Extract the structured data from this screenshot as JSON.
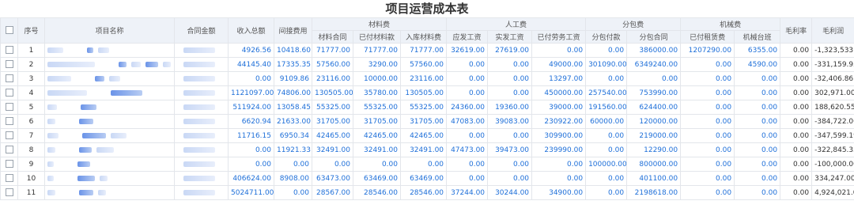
{
  "title": "项目运营成本表",
  "groups": {
    "material": "材料费",
    "labor": "人工费",
    "subcontract": "分包费",
    "machinery": "机械费"
  },
  "columns": {
    "seq": "序号",
    "project_name": "项目名称",
    "contract_amount": "合同金额",
    "total_income": "收入总额",
    "indirect_cost": "间接费用",
    "material_contract": "材料合同",
    "material_paid": "已付材料款",
    "material_inbound": "入库材料费",
    "labor_due": "应发工资",
    "labor_actual": "实发工资",
    "labor_paid": "已付劳务工资",
    "sub_paid": "分包付款",
    "sub_contract": "分包合同",
    "mach_rent_paid": "已付租赁费",
    "mach_shift": "机械台班",
    "gross_rate": "毛利率",
    "gross_profit": "毛利润"
  },
  "rows": [
    {
      "seq": "1",
      "total_income": "4926.56",
      "indirect_cost": "10418.60",
      "material_contract": "71777.00",
      "material_paid": "71777.00",
      "material_inbound": "71777.00",
      "labor_due": "32619.00",
      "labor_actual": "27619.00",
      "labor_paid": "0.00",
      "sub_paid": "0.00",
      "sub_contract": "386000.00",
      "mach_rent_paid": "1207290.00",
      "mach_shift": "6355.00",
      "gross_rate": "0.00",
      "gross_profit": "-1,323,533.04"
    },
    {
      "seq": "2",
      "total_income": "44145.40",
      "indirect_cost": "17335.35",
      "material_contract": "57560.00",
      "material_paid": "3290.00",
      "material_inbound": "57560.00",
      "labor_due": "0.00",
      "labor_actual": "0.00",
      "labor_paid": "49000.00",
      "sub_paid": "301090.00",
      "sub_contract": "6349240.00",
      "mach_rent_paid": "0.00",
      "mach_shift": "4590.00",
      "gross_rate": "0.00",
      "gross_profit": "-331,159.95"
    },
    {
      "seq": "3",
      "total_income": "0.00",
      "indirect_cost": "9109.86",
      "material_contract": "23116.00",
      "material_paid": "10000.00",
      "material_inbound": "23116.00",
      "labor_due": "0.00",
      "labor_actual": "0.00",
      "labor_paid": "13297.00",
      "sub_paid": "0.00",
      "sub_contract": "0.00",
      "mach_rent_paid": "0.00",
      "mach_shift": "0.00",
      "gross_rate": "0.00",
      "gross_profit": "-32,406.86"
    },
    {
      "seq": "4",
      "total_income": "1121097.00",
      "indirect_cost": "74806.00",
      "material_contract": "130505.00",
      "material_paid": "35780.00",
      "material_inbound": "130505.00",
      "labor_due": "0.00",
      "labor_actual": "0.00",
      "labor_paid": "450000.00",
      "sub_paid": "257540.00",
      "sub_contract": "753990.00",
      "mach_rent_paid": "0.00",
      "mach_shift": "0.00",
      "gross_rate": "0.00",
      "gross_profit": "302,971.00"
    },
    {
      "seq": "5",
      "total_income": "511924.00",
      "indirect_cost": "13058.45",
      "material_contract": "55325.00",
      "material_paid": "55325.00",
      "material_inbound": "55325.00",
      "labor_due": "24360.00",
      "labor_actual": "19360.00",
      "labor_paid": "39000.00",
      "sub_paid": "191560.00",
      "sub_contract": "624400.00",
      "mach_rent_paid": "0.00",
      "mach_shift": "0.00",
      "gross_rate": "0.00",
      "gross_profit": "188,620.55"
    },
    {
      "seq": "6",
      "total_income": "6620.94",
      "indirect_cost": "21633.00",
      "material_contract": "31705.00",
      "material_paid": "31705.00",
      "material_inbound": "31705.00",
      "labor_due": "47083.00",
      "labor_actual": "39083.00",
      "labor_paid": "230922.00",
      "sub_paid": "60000.00",
      "sub_contract": "120000.00",
      "mach_rent_paid": "0.00",
      "mach_shift": "0.00",
      "gross_rate": "0.00",
      "gross_profit": "-384,722.06"
    },
    {
      "seq": "7",
      "total_income": "11716.15",
      "indirect_cost": "6950.34",
      "material_contract": "42465.00",
      "material_paid": "42465.00",
      "material_inbound": "42465.00",
      "labor_due": "0.00",
      "labor_actual": "0.00",
      "labor_paid": "309900.00",
      "sub_paid": "0.00",
      "sub_contract": "219000.00",
      "mach_rent_paid": "0.00",
      "mach_shift": "0.00",
      "gross_rate": "0.00",
      "gross_profit": "-347,599.19"
    },
    {
      "seq": "8",
      "total_income": "0.00",
      "indirect_cost": "11921.33",
      "material_contract": "32491.00",
      "material_paid": "32491.00",
      "material_inbound": "32491.00",
      "labor_due": "47473.00",
      "labor_actual": "39473.00",
      "labor_paid": "239990.00",
      "sub_paid": "0.00",
      "sub_contract": "12290.00",
      "mach_rent_paid": "0.00",
      "mach_shift": "0.00",
      "gross_rate": "0.00",
      "gross_profit": "-322,845.33"
    },
    {
      "seq": "9",
      "total_income": "0.00",
      "indirect_cost": "0.00",
      "material_contract": "0.00",
      "material_paid": "0.00",
      "material_inbound": "0.00",
      "labor_due": "0.00",
      "labor_actual": "0.00",
      "labor_paid": "0.00",
      "sub_paid": "100000.00",
      "sub_contract": "800000.00",
      "mach_rent_paid": "0.00",
      "mach_shift": "0.00",
      "gross_rate": "0.00",
      "gross_profit": "-100,000.00"
    },
    {
      "seq": "10",
      "total_income": "406624.00",
      "indirect_cost": "8908.00",
      "material_contract": "63473.00",
      "material_paid": "63469.00",
      "material_inbound": "63469.00",
      "labor_due": "0.00",
      "labor_actual": "0.00",
      "labor_paid": "0.00",
      "sub_paid": "0.00",
      "sub_contract": "401100.00",
      "mach_rent_paid": "0.00",
      "mach_shift": "0.00",
      "gross_rate": "0.00",
      "gross_profit": "334,247.00"
    },
    {
      "seq": "11",
      "total_income": "5024711.00",
      "indirect_cost": "0.00",
      "material_contract": "28567.00",
      "material_paid": "28546.00",
      "material_inbound": "28546.00",
      "labor_due": "37244.00",
      "labor_actual": "30244.00",
      "labor_paid": "34900.00",
      "sub_paid": "0.00",
      "sub_contract": "2198618.00",
      "mach_rent_paid": "0.00",
      "mach_shift": "0.00",
      "gross_rate": "0.00",
      "gross_profit": "4,924,021.00"
    }
  ]
}
